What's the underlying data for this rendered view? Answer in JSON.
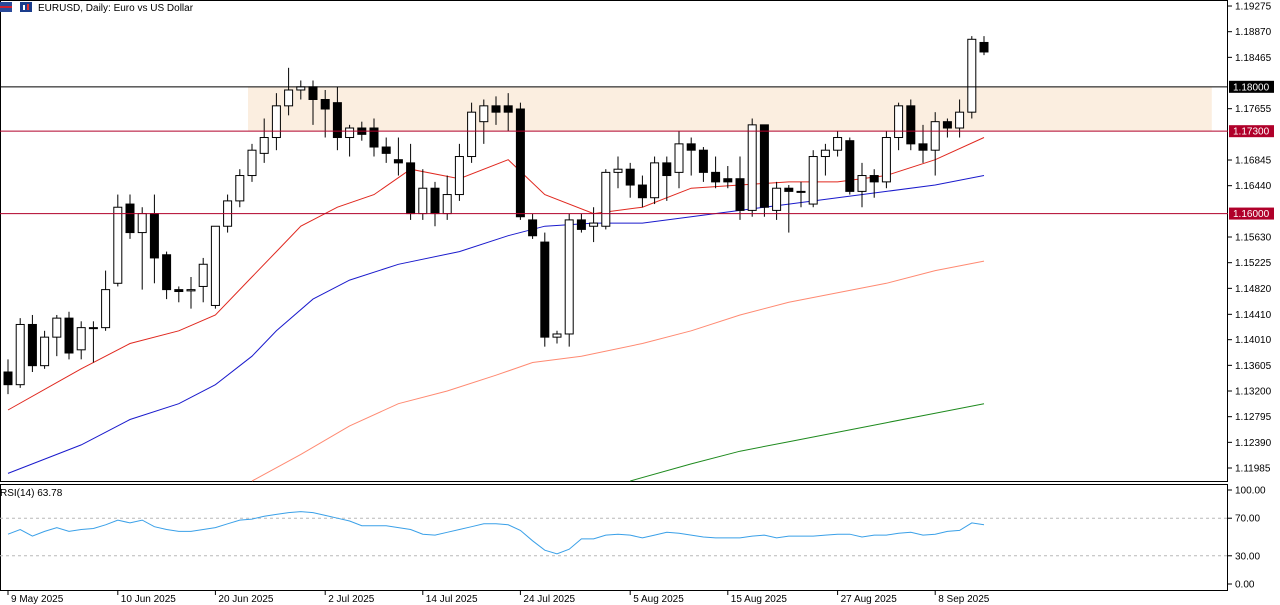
{
  "header": {
    "symbol_title": "EURUSD, Daily:  Euro vs US Dollar"
  },
  "rsi_panel": {
    "label": "RSI(14) 63.78",
    "levels": [
      100,
      70,
      30,
      0
    ],
    "level_labels": [
      "100.00",
      "70.00",
      "30.00",
      "0.00"
    ]
  },
  "colors": {
    "bull_body": "#ffffff",
    "bear_body": "#000000",
    "ma_fast": "#e0281f",
    "ma_mid": "#1a1acc",
    "ma_slow": "#ff8a72",
    "ma_long": "#1e8a1e",
    "rsi_line": "#3aa0e8",
    "resistance_zone": "#fbeee0",
    "level_red": "#b0002a",
    "level_black": "#000000"
  },
  "chart_data": {
    "type": "candlestick",
    "symbol": "EURUSD",
    "timeframe": "Daily",
    "ylim": [
      1.1178,
      1.1937
    ],
    "y_ticks": [
      "1.19275",
      "1.18870",
      "1.18465",
      "1.17655",
      "1.16845",
      "1.16440",
      "1.15630",
      "1.15225",
      "1.14820",
      "1.14410",
      "1.14010",
      "1.13605",
      "1.13200",
      "1.12795",
      "1.12390",
      "1.11985"
    ],
    "price_tags": [
      {
        "label": "1.18000",
        "value": 1.18,
        "style": "black"
      },
      {
        "label": "1.17300",
        "value": 1.173,
        "style": "red"
      },
      {
        "label": "1.16000",
        "value": 1.16,
        "style": "red"
      }
    ],
    "zone": {
      "from_index": 20,
      "to_index": 99,
      "low": 1.173,
      "high": 1.18
    },
    "x_ticks": [
      {
        "label": "9 May 2025",
        "index": 0
      },
      {
        "label": "10 Jun 2025",
        "index": 9
      },
      {
        "label": "20 Jun 2025",
        "index": 17
      },
      {
        "label": "2 Jul 2025",
        "index": 26
      },
      {
        "label": "14 Jul 2025",
        "index": 34
      },
      {
        "label": "24 Jul 2025",
        "index": 42
      },
      {
        "label": "5 Aug 2025",
        "index": 51
      },
      {
        "label": "15 Aug 2025",
        "index": 59
      },
      {
        "label": "27 Aug 2025",
        "index": 68
      },
      {
        "label": "8 Sep 2025",
        "index": 76
      }
    ],
    "candles": [
      [
        1.135,
        1.137,
        1.1315,
        1.133
      ],
      [
        1.133,
        1.1435,
        1.1325,
        1.1425
      ],
      [
        1.1425,
        1.144,
        1.135,
        1.136
      ],
      [
        1.136,
        1.1415,
        1.1355,
        1.1405
      ],
      [
        1.1405,
        1.144,
        1.1375,
        1.1435
      ],
      [
        1.1435,
        1.1445,
        1.137,
        1.138
      ],
      [
        1.1385,
        1.143,
        1.137,
        1.142
      ],
      [
        1.142,
        1.143,
        1.1365,
        1.142
      ],
      [
        1.142,
        1.151,
        1.1415,
        1.148
      ],
      [
        1.149,
        1.163,
        1.1485,
        1.161
      ],
      [
        1.1615,
        1.163,
        1.156,
        1.157
      ],
      [
        1.157,
        1.161,
        1.148,
        1.16
      ],
      [
        1.16,
        1.163,
        1.149,
        1.153
      ],
      [
        1.1535,
        1.154,
        1.1465,
        1.148
      ],
      [
        1.148,
        1.1485,
        1.146,
        1.1477
      ],
      [
        1.1478,
        1.15,
        1.145,
        1.148
      ],
      [
        1.1485,
        1.153,
        1.146,
        1.152
      ],
      [
        1.1455,
        1.158,
        1.145,
        1.158
      ],
      [
        1.158,
        1.163,
        1.157,
        1.162
      ],
      [
        1.162,
        1.167,
        1.161,
        1.166
      ],
      [
        1.166,
        1.171,
        1.165,
        1.17
      ],
      [
        1.1695,
        1.175,
        1.168,
        1.172
      ],
      [
        1.172,
        1.179,
        1.17,
        1.177
      ],
      [
        1.177,
        1.183,
        1.1755,
        1.1795
      ],
      [
        1.1795,
        1.181,
        1.178,
        1.18
      ],
      [
        1.18,
        1.181,
        1.174,
        1.178
      ],
      [
        1.178,
        1.1795,
        1.172,
        1.1765
      ],
      [
        1.1775,
        1.18,
        1.17,
        1.172
      ],
      [
        1.172,
        1.174,
        1.169,
        1.1735
      ],
      [
        1.1735,
        1.1745,
        1.1715,
        1.1725
      ],
      [
        1.1735,
        1.175,
        1.169,
        1.1705
      ],
      [
        1.1705,
        1.172,
        1.168,
        1.1695
      ],
      [
        1.1685,
        1.172,
        1.166,
        1.168
      ],
      [
        1.168,
        1.171,
        1.159,
        1.16
      ],
      [
        1.16,
        1.167,
        1.159,
        1.164
      ],
      [
        1.164,
        1.165,
        1.158,
        1.16
      ],
      [
        1.16,
        1.166,
        1.159,
        1.163
      ],
      [
        1.163,
        1.171,
        1.162,
        1.169
      ],
      [
        1.169,
        1.1775,
        1.168,
        1.176
      ],
      [
        1.1745,
        1.178,
        1.171,
        1.177
      ],
      [
        1.177,
        1.1785,
        1.174,
        1.176
      ],
      [
        1.177,
        1.179,
        1.173,
        1.176
      ],
      [
        1.1765,
        1.1775,
        1.159,
        1.1595
      ],
      [
        1.159,
        1.16,
        1.156,
        1.1565
      ],
      [
        1.1555,
        1.157,
        1.139,
        1.1405
      ],
      [
        1.1405,
        1.1415,
        1.1395,
        1.141
      ],
      [
        1.141,
        1.16,
        1.139,
        1.159
      ],
      [
        1.159,
        1.16,
        1.157,
        1.1575
      ],
      [
        1.158,
        1.161,
        1.1555,
        1.1585
      ],
      [
        1.158,
        1.167,
        1.1575,
        1.1665
      ],
      [
        1.1665,
        1.169,
        1.164,
        1.167
      ],
      [
        1.167,
        1.168,
        1.1625,
        1.1645
      ],
      [
        1.1645,
        1.166,
        1.161,
        1.1625
      ],
      [
        1.1625,
        1.169,
        1.1615,
        1.168
      ],
      [
        1.168,
        1.169,
        1.162,
        1.166
      ],
      [
        1.1665,
        1.173,
        1.164,
        1.171
      ],
      [
        1.171,
        1.172,
        1.166,
        1.17
      ],
      [
        1.17,
        1.1705,
        1.165,
        1.1665
      ],
      [
        1.1665,
        1.169,
        1.164,
        1.165
      ],
      [
        1.1655,
        1.1675,
        1.164,
        1.165
      ],
      [
        1.1655,
        1.169,
        1.159,
        1.1605
      ],
      [
        1.1605,
        1.175,
        1.1595,
        1.174
      ],
      [
        1.174,
        1.174,
        1.1595,
        1.161
      ],
      [
        1.1605,
        1.165,
        1.159,
        1.164
      ],
      [
        1.164,
        1.1645,
        1.157,
        1.1635
      ],
      [
        1.1635,
        1.165,
        1.161,
        1.1635
      ],
      [
        1.1615,
        1.17,
        1.161,
        1.169
      ],
      [
        1.169,
        1.171,
        1.166,
        1.17
      ],
      [
        1.17,
        1.173,
        1.169,
        1.172
      ],
      [
        1.1715,
        1.172,
        1.163,
        1.1635
      ],
      [
        1.1635,
        1.168,
        1.161,
        1.166
      ],
      [
        1.166,
        1.167,
        1.1625,
        1.165
      ],
      [
        1.165,
        1.173,
        1.164,
        1.172
      ],
      [
        1.172,
        1.1775,
        1.17,
        1.177
      ],
      [
        1.177,
        1.178,
        1.17,
        1.171
      ],
      [
        1.171,
        1.174,
        1.168,
        1.17
      ],
      [
        1.17,
        1.176,
        1.166,
        1.1745
      ],
      [
        1.1745,
        1.175,
        1.172,
        1.1735
      ],
      [
        1.1735,
        1.178,
        1.172,
        1.176
      ],
      [
        1.176,
        1.188,
        1.175,
        1.1875
      ],
      [
        1.187,
        1.188,
        1.185,
        1.1855
      ]
    ],
    "moving_averages": [
      {
        "color_key": "ma_fast",
        "points": [
          [
            0,
            1.129
          ],
          [
            6,
            1.1355
          ],
          [
            10,
            1.1395
          ],
          [
            14,
            1.1415
          ],
          [
            17,
            1.144
          ],
          [
            20,
            1.15
          ],
          [
            22,
            1.154
          ],
          [
            24,
            1.158
          ],
          [
            27,
            1.161
          ],
          [
            30,
            1.163
          ],
          [
            33,
            1.167
          ],
          [
            37,
            1.1655
          ],
          [
            41,
            1.1685
          ],
          [
            44,
            1.163
          ],
          [
            48,
            1.16
          ],
          [
            52,
            1.161
          ],
          [
            56,
            1.164
          ],
          [
            60,
            1.1645
          ],
          [
            64,
            1.165
          ],
          [
            68,
            1.165
          ],
          [
            72,
            1.166
          ],
          [
            76,
            1.1685
          ],
          [
            80,
            1.172
          ]
        ]
      },
      {
        "color_key": "ma_mid",
        "points": [
          [
            0,
            1.119
          ],
          [
            6,
            1.1235
          ],
          [
            10,
            1.1275
          ],
          [
            14,
            1.13
          ],
          [
            17,
            1.133
          ],
          [
            20,
            1.1375
          ],
          [
            22,
            1.1415
          ],
          [
            25,
            1.1465
          ],
          [
            28,
            1.1495
          ],
          [
            32,
            1.152
          ],
          [
            37,
            1.154
          ],
          [
            41,
            1.1565
          ],
          [
            44,
            1.158
          ],
          [
            48,
            1.1585
          ],
          [
            52,
            1.1585
          ],
          [
            56,
            1.1595
          ],
          [
            60,
            1.1605
          ],
          [
            64,
            1.1615
          ],
          [
            68,
            1.1625
          ],
          [
            72,
            1.1635
          ],
          [
            76,
            1.1645
          ],
          [
            80,
            1.166
          ]
        ]
      },
      {
        "color_key": "ma_slow",
        "points": [
          [
            20,
            1.1178
          ],
          [
            24,
            1.122
          ],
          [
            28,
            1.1265
          ],
          [
            32,
            1.13
          ],
          [
            36,
            1.132
          ],
          [
            40,
            1.1345
          ],
          [
            43,
            1.1365
          ],
          [
            47,
            1.1375
          ],
          [
            52,
            1.1395
          ],
          [
            56,
            1.1415
          ],
          [
            60,
            1.144
          ],
          [
            64,
            1.146
          ],
          [
            68,
            1.1475
          ],
          [
            72,
            1.149
          ],
          [
            76,
            1.151
          ],
          [
            80,
            1.1525
          ]
        ]
      },
      {
        "color_key": "ma_long",
        "points": [
          [
            51,
            1.1178
          ],
          [
            56,
            1.1205
          ],
          [
            60,
            1.1225
          ],
          [
            64,
            1.124
          ],
          [
            68,
            1.1255
          ],
          [
            72,
            1.127
          ],
          [
            76,
            1.1285
          ],
          [
            80,
            1.13
          ]
        ]
      }
    ],
    "rsi": [
      53,
      58,
      51,
      56,
      60,
      56,
      58,
      59,
      63,
      68,
      65,
      68,
      61,
      58,
      56,
      56,
      58,
      60,
      64,
      68,
      69,
      72,
      74,
      76,
      77,
      76,
      73,
      70,
      67,
      62,
      62,
      62,
      60,
      58,
      53,
      52,
      55,
      58,
      61,
      64,
      64,
      63,
      57,
      46,
      36,
      32,
      37,
      48,
      48,
      52,
      53,
      52,
      49,
      52,
      55,
      54,
      52,
      50,
      49,
      49,
      49,
      51,
      52,
      49,
      51,
      51,
      51,
      52,
      53,
      53,
      50,
      52,
      52,
      54,
      55,
      52,
      53,
      56,
      57,
      65,
      63
    ]
  }
}
